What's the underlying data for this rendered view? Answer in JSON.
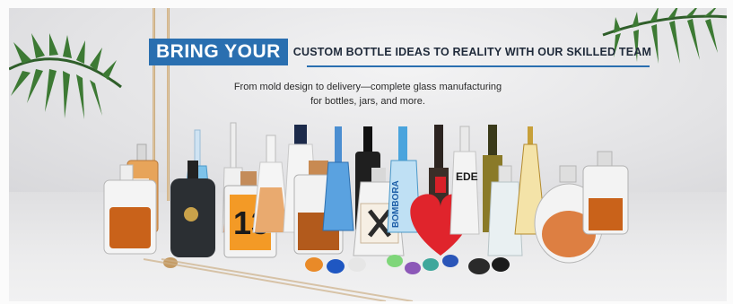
{
  "banner": {
    "headline_highlight": "BRING YOUR",
    "headline_rest": "CUSTOM BOTTLE IDEAS TO REALITY WITH OUR SKILLED TEAM",
    "subtitle_line1": "From mold design to delivery—complete glass manufacturing",
    "subtitle_line2": "for bottles, jars, and more."
  },
  "product_labels": {
    "number_13": "13",
    "bombora": "BOMBORA",
    "ede": "EDE"
  },
  "colors": {
    "accent_blue": "#2a6fb0",
    "headline_text": "#1f2a3a",
    "amber": "#c9621a",
    "heart_red": "#e0242c"
  }
}
